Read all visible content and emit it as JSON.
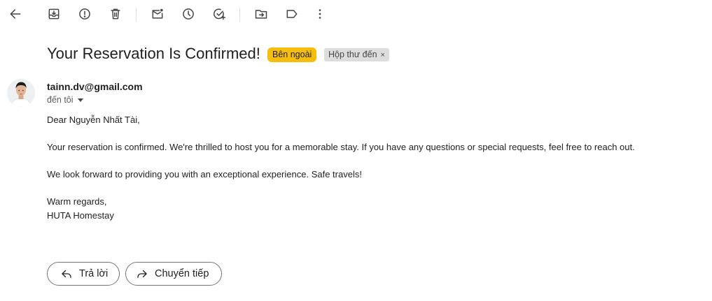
{
  "toolbar": {
    "icons": [
      "back-arrow-icon",
      "archive-icon",
      "report-spam-icon",
      "delete-icon",
      "mark-unread-icon",
      "snooze-icon",
      "add-to-tasks-icon",
      "move-to-icon",
      "label-icon",
      "more-options-icon"
    ]
  },
  "email": {
    "subject": "Your Reservation Is Confirmed!",
    "labels": {
      "external": "Bên ngoài",
      "inbox": "Hộp thư đến",
      "inbox_remove": "×"
    },
    "sender": "tainn.dv@gmail.com",
    "to_me": "đến tôi",
    "body": {
      "greeting": "Dear Nguyễn Nhất Tài,",
      "paragraph1": "Your reservation is confirmed. We're thrilled to host you for a memorable stay. If you have any questions or special requests, feel free to reach out.",
      "paragraph2": "We look forward to providing you with an exceptional experience. Safe travels!",
      "closing": "Warm regards,",
      "signature": "HUTA Homestay"
    }
  },
  "actions": {
    "reply_label": "Trả lời",
    "forward_label": "Chuyển tiếp"
  },
  "colors": {
    "external_label_bg": "#f6be0b",
    "inbox_label_bg": "#dddddd",
    "button_border": "#747775"
  }
}
